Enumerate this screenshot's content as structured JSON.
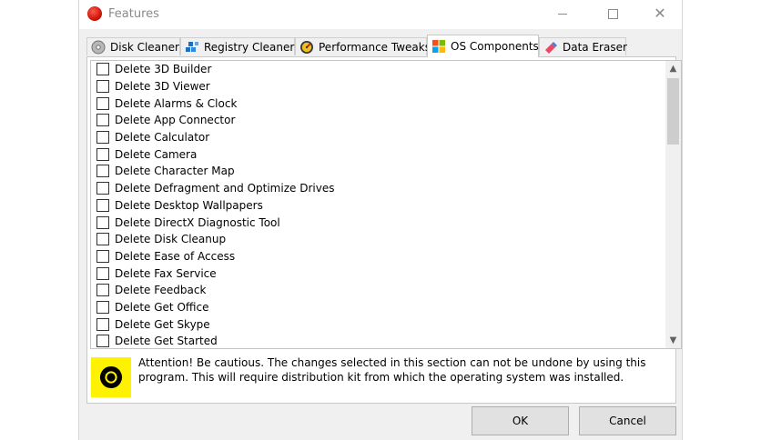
{
  "window": {
    "title": "Features",
    "icon": "red-circle-app-icon"
  },
  "tabs": [
    {
      "label": "Disk Cleaner",
      "icon": "disk-icon",
      "active": false
    },
    {
      "label": "Registry Cleaner",
      "icon": "registry-cubes-icon",
      "active": false
    },
    {
      "label": "Performance Tweaks",
      "icon": "gauge-icon",
      "active": false
    },
    {
      "label": "OS Components",
      "icon": "windows-logo-icon",
      "active": true
    },
    {
      "label": "Data Eraser",
      "icon": "eraser-icon",
      "active": false
    }
  ],
  "components": [
    {
      "label": "Delete 3D Builder",
      "checked": false
    },
    {
      "label": "Delete 3D Viewer",
      "checked": false
    },
    {
      "label": "Delete Alarms & Clock",
      "checked": false
    },
    {
      "label": "Delete App Connector",
      "checked": false
    },
    {
      "label": "Delete Calculator",
      "checked": false
    },
    {
      "label": "Delete Camera",
      "checked": false
    },
    {
      "label": "Delete Character Map",
      "checked": false
    },
    {
      "label": "Delete Defragment and Optimize Drives",
      "checked": false
    },
    {
      "label": "Delete Desktop Wallpapers",
      "checked": false
    },
    {
      "label": "Delete DirectX Diagnostic Tool",
      "checked": false
    },
    {
      "label": "Delete Disk Cleanup",
      "checked": false
    },
    {
      "label": "Delete Ease of Access",
      "checked": false
    },
    {
      "label": "Delete Fax Service",
      "checked": false
    },
    {
      "label": "Delete Feedback",
      "checked": false
    },
    {
      "label": "Delete Get Office",
      "checked": false
    },
    {
      "label": "Delete Get Skype",
      "checked": false
    },
    {
      "label": "Delete Get Started",
      "checked": false
    }
  ],
  "warning": {
    "icon": "radiation-hazard-icon",
    "text": "Attention! Be cautious. The changes selected in this section can not be undone by using this program. This will require distribution kit from which the operating system was installed."
  },
  "buttons": {
    "ok": "OK",
    "cancel": "Cancel"
  },
  "colors": {
    "accent_warning": "#fff200",
    "app_icon": "#d21a0e"
  }
}
